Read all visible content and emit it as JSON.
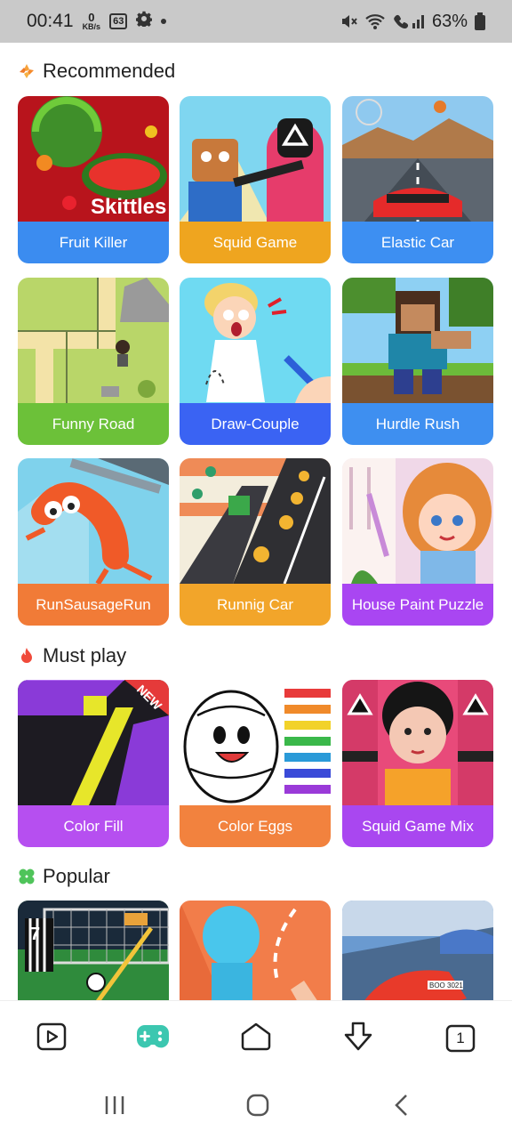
{
  "status_bar": {
    "time": "00:41",
    "net_speed_value": "0",
    "net_speed_unit": "KB/s",
    "badge": "63",
    "battery": "63%"
  },
  "sections": [
    {
      "title": "Recommended",
      "icon": "recommended-icon",
      "cards": [
        {
          "label": "Fruit Killer",
          "color": "#3b8cf0"
        },
        {
          "label": "Squid Game",
          "color": "#efa51f"
        },
        {
          "label": "Elastic Car",
          "color": "#3d8ff2"
        },
        {
          "label": "Funny Road",
          "color": "#6cc139"
        },
        {
          "label": "Draw-Couple",
          "color": "#3a63f3"
        },
        {
          "label": "Hurdle Rush",
          "color": "#3e8ff0"
        },
        {
          "label": "RunSausageRun",
          "color": "#f17b37"
        },
        {
          "label": "Runnig Car",
          "color": "#f2a52a"
        },
        {
          "label": "House Paint Puzzle",
          "color": "#a946f2"
        }
      ]
    },
    {
      "title": "Must play",
      "icon": "flame-icon",
      "cards": [
        {
          "label": "Color Fill",
          "color": "#b64ff0"
        },
        {
          "label": "Color Eggs",
          "color": "#f2823e"
        },
        {
          "label": "Squid Game Mix",
          "color": "#a947f0"
        }
      ]
    },
    {
      "title": "Popular",
      "icon": "clover-icon",
      "cards": [
        {
          "label": "",
          "color": "#2f8b3c"
        },
        {
          "label": "",
          "color": "#f27d4a"
        },
        {
          "label": "",
          "color": "#5b8fc7"
        }
      ]
    }
  ],
  "thumb_text": {
    "skittles": "Skittles",
    "new": "NEW",
    "jersey": "7",
    "car_plate": "BOO 3021"
  },
  "bottom_nav": {
    "active_color": "#3cc7b0",
    "tab_count": "1",
    "items": [
      "video-icon",
      "gamepad-icon",
      "home-icon",
      "download-icon",
      "tabs-icon"
    ]
  }
}
